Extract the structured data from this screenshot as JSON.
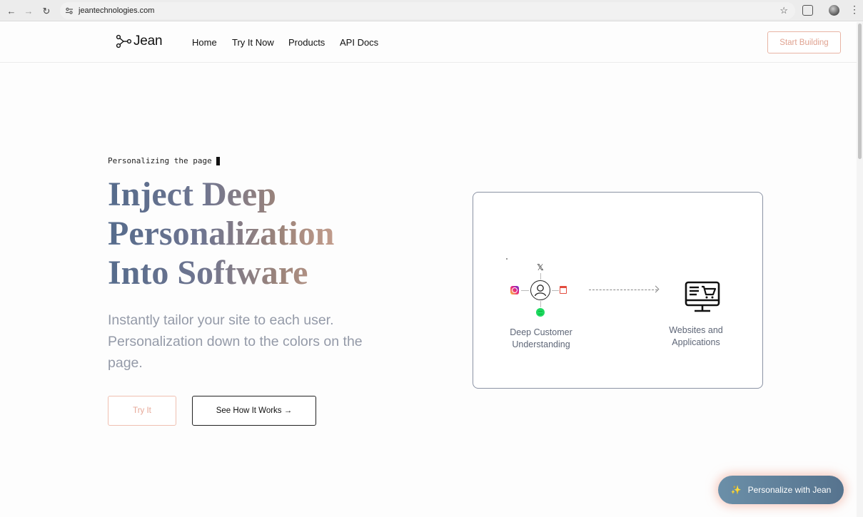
{
  "browser": {
    "url": "jeantechnologies.com",
    "back_icon": "←",
    "forward_icon": "→",
    "reload_icon": "↻",
    "star_icon": "☆",
    "menu_icon": "⋮"
  },
  "header": {
    "logo_text": "Jean",
    "nav": [
      "Home",
      "Try It Now",
      "Products",
      "API Docs"
    ],
    "cta_label": "Start Building"
  },
  "hero": {
    "typing_text": "Personalizing the page",
    "headline": [
      "Inject Deep",
      "Personalization",
      "Into Software"
    ],
    "subtext": "Instantly tailor your site to each user. Personalization down to the colors on the page.",
    "primary_button": "Try It",
    "secondary_button": "See How It Works →"
  },
  "diagram": {
    "left_label": "Deep Customer Understanding",
    "right_label": "Websites and Applications",
    "x_glyph": "𝕏"
  },
  "fab": {
    "sparkle": "✨",
    "label": "Personalize with Jean"
  },
  "colors": {
    "accent_peach": "#e8b4a4",
    "headline_start": "#556b8c",
    "headline_end": "#c8a08f",
    "fab_bg": "#6b8fa8"
  }
}
